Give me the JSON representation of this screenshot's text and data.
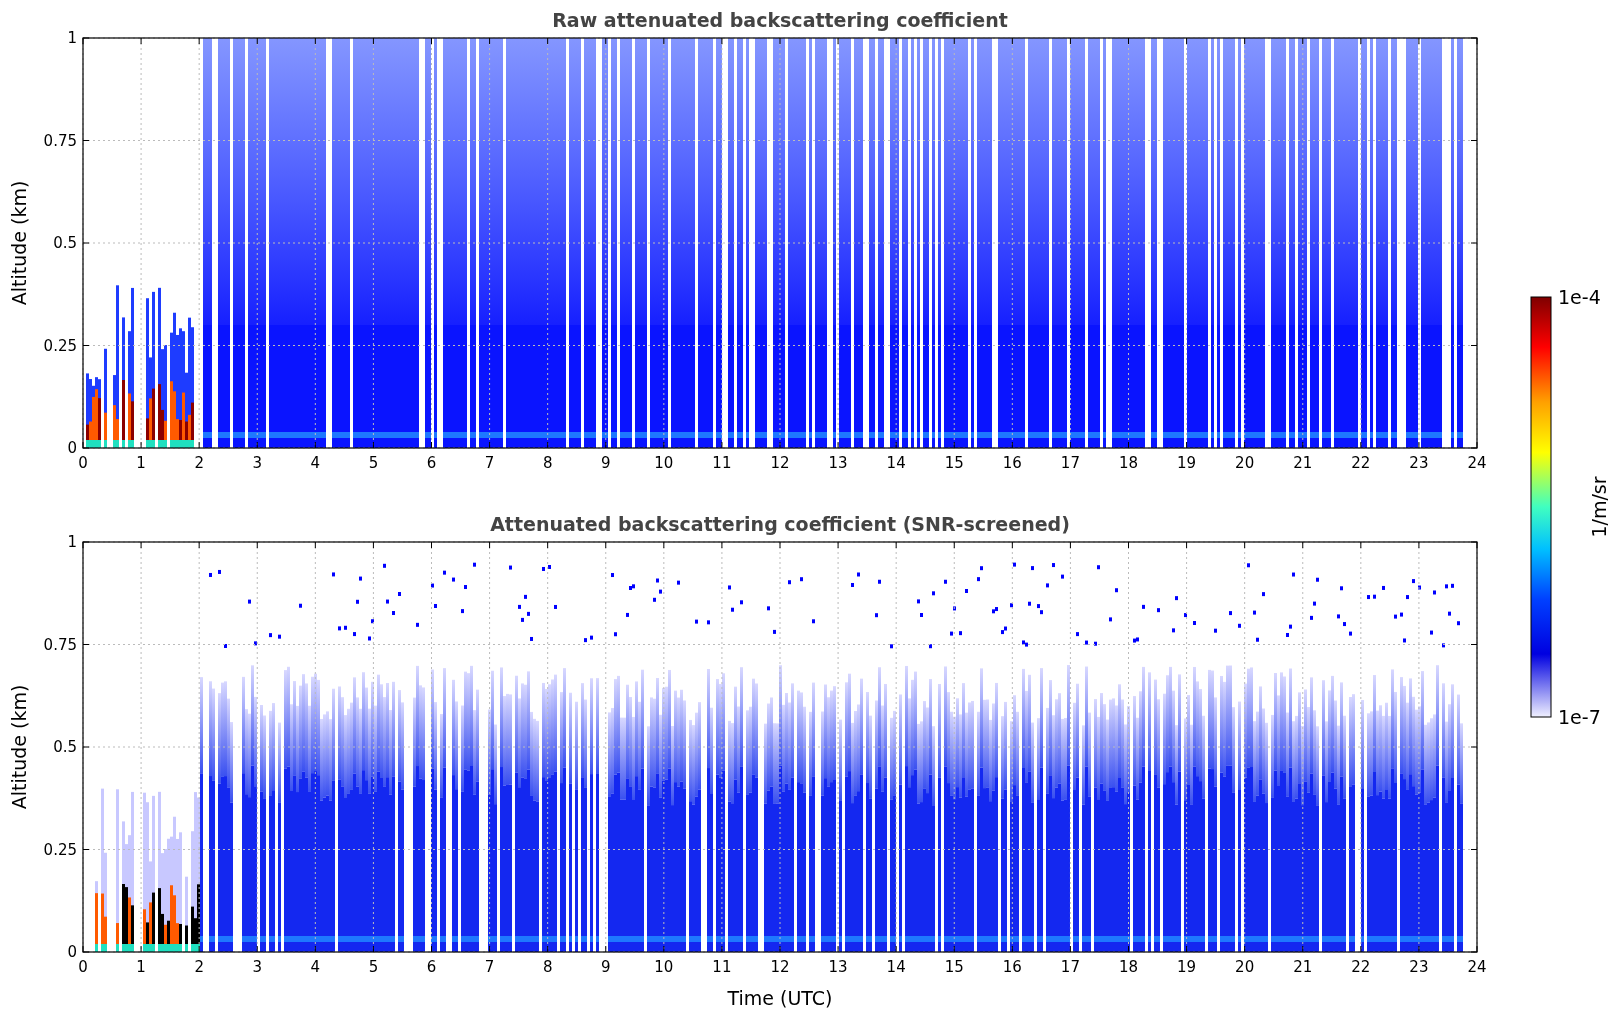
{
  "panels": [
    {
      "title": "Raw attenuated backscattering coefficient",
      "ylabel": "Altitude (km)",
      "yticks": [
        "1",
        "0.75",
        "0.5",
        "0.25",
        "0"
      ],
      "xticks": [
        "0",
        "1",
        "2",
        "3",
        "4",
        "5",
        "6",
        "7",
        "8",
        "9",
        "10",
        "11",
        "12",
        "13",
        "14",
        "15",
        "16",
        "17",
        "18",
        "19",
        "20",
        "21",
        "22",
        "23",
        "24"
      ],
      "kind": "raw"
    },
    {
      "title": "Attenuated backscattering coefficient (SNR-screened)",
      "ylabel": "Altitude (km)",
      "yticks": [
        "1",
        "0.75",
        "0.5",
        "0.25",
        "0"
      ],
      "xticks": [
        "0",
        "1",
        "2",
        "3",
        "4",
        "5",
        "6",
        "7",
        "8",
        "9",
        "10",
        "11",
        "12",
        "13",
        "14",
        "15",
        "16",
        "17",
        "18",
        "19",
        "20",
        "21",
        "22",
        "23",
        "24"
      ],
      "kind": "screened"
    }
  ],
  "xlabel": "Time (UTC)",
  "colorbar": {
    "max_label": "1e-4",
    "min_label": "1e-7",
    "label": "1/m/sr"
  }
}
